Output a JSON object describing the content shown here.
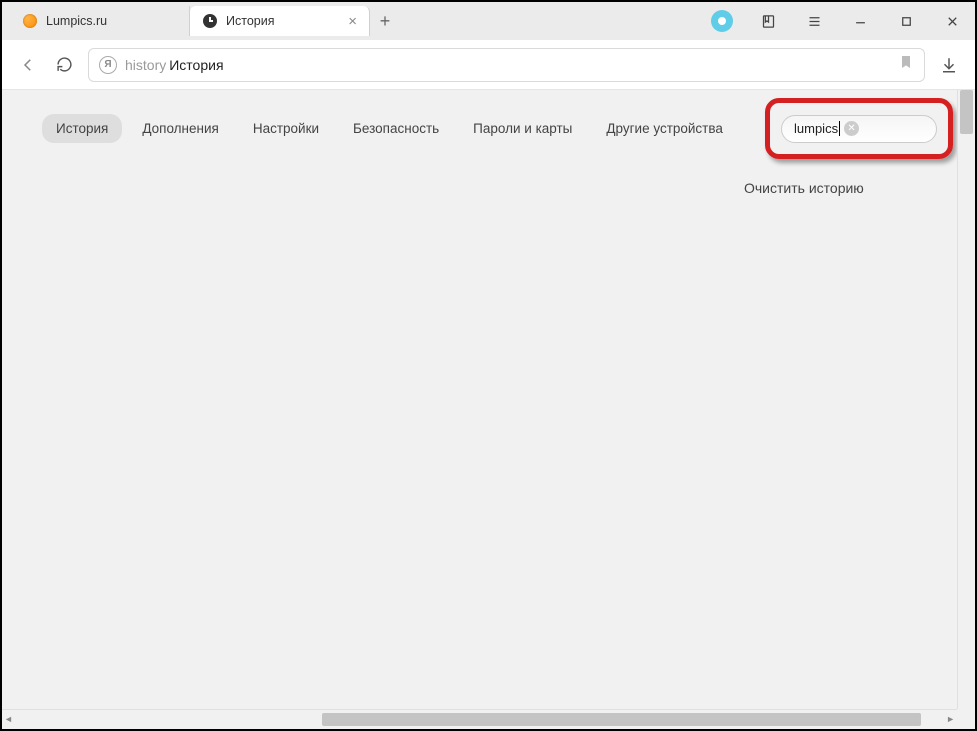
{
  "tabs": [
    {
      "title": "Lumpics.ru",
      "favicon": "orange"
    },
    {
      "title": "История",
      "favicon": "clock",
      "active": true
    }
  ],
  "address": {
    "prefix": "history",
    "page": "История"
  },
  "nav": {
    "items": [
      {
        "label": "История",
        "active": true
      },
      {
        "label": "Дополнения"
      },
      {
        "label": "Настройки"
      },
      {
        "label": "Безопасность"
      },
      {
        "label": "Пароли и карты"
      },
      {
        "label": "Другие устройства"
      }
    ]
  },
  "search": {
    "value": "lumpics"
  },
  "actions": {
    "clear_history": "Очистить историю"
  },
  "icons": {
    "close_tab": "×",
    "new_tab": "+"
  }
}
